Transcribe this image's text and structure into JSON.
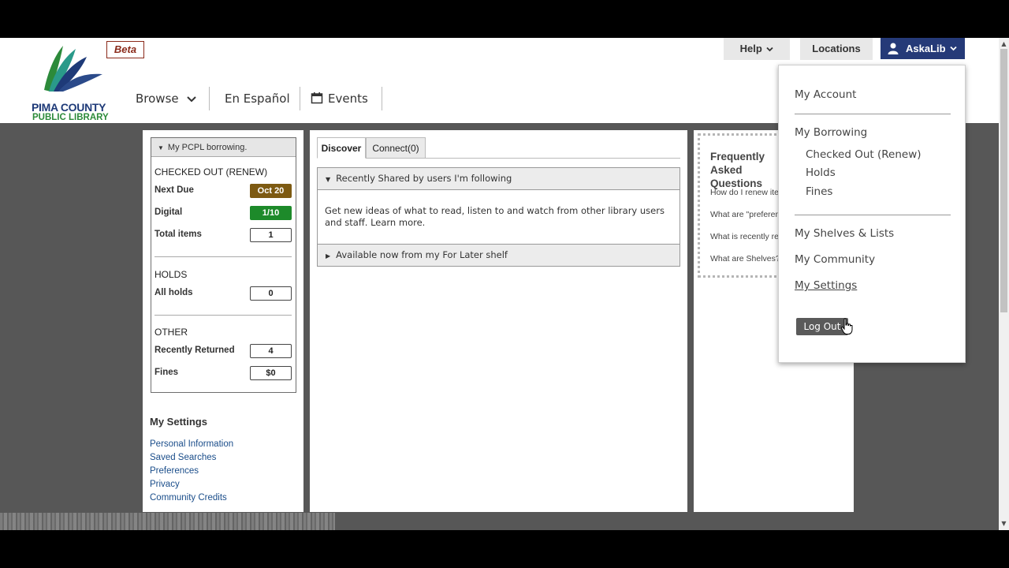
{
  "header": {
    "logo_line1": "PIMA COUNTY",
    "logo_line2": "PUBLIC LIBRARY",
    "beta": "Beta",
    "nav": {
      "browse": "Browse",
      "espanol": "En Español",
      "events": "Events"
    },
    "help": "Help",
    "locations": "Locations",
    "user": "AskaLib"
  },
  "borrowing": {
    "header": "My PCPL borrowing.",
    "checked_out_title": "CHECKED OUT (RENEW)",
    "next_due_label": "Next Due",
    "next_due_value": "Oct 20",
    "digital_label": "Digital",
    "digital_value": "1/10",
    "total_label": "Total items",
    "total_value": "1",
    "holds_title": "HOLDS",
    "all_holds_label": "All holds",
    "all_holds_value": "0",
    "other_title": "OTHER",
    "recently_returned_label": "Recently Returned",
    "recently_returned_value": "4",
    "fines_label": "Fines",
    "fines_value": "$0"
  },
  "settings_panel": {
    "title": "My Settings",
    "links": [
      "Personal Information",
      "Saved Searches",
      "Preferences",
      "Privacy",
      "Community Credits"
    ]
  },
  "main": {
    "tabs": [
      "Discover",
      "Connect(0)"
    ],
    "recently_shared": "Recently Shared by users I'm following",
    "recently_shared_body": "Get new ideas of what to read, listen to and watch from other library users and staff. Learn more.",
    "available_now": "Available now from my For Later shelf"
  },
  "faq": {
    "title": "Frequently Asked Questions",
    "items": [
      "How do I renew items?",
      "What are \"preferences\"?",
      "What is recently returned?",
      "What are Shelves?"
    ]
  },
  "dropdown": {
    "my_account": "My Account",
    "my_borrowing": "My Borrowing",
    "checked_out": "Checked Out (Renew)",
    "holds": "Holds",
    "fines": "Fines",
    "shelves": "My Shelves & Lists",
    "community": "My Community",
    "settings": "My Settings",
    "logout": "Log Out"
  },
  "colors": {
    "brand_navy": "#253a78",
    "due_badge": "#7d5a12",
    "digital_badge": "#1d8a2a"
  }
}
